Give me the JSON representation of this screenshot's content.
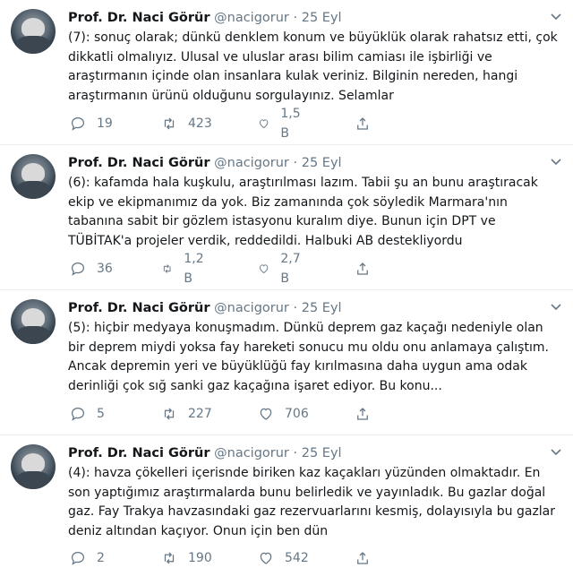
{
  "tweets": [
    {
      "author": "Prof. Dr. Naci Görür",
      "handle": "@nacigorur",
      "sep": "·",
      "date": "25 Eyl",
      "text": "(7): sonuç olarak; dünkü denklem konum ve büyüklük olarak rahatsız etti, çok dikkatli olmalıyız. Ulusal ve uluslar arası bilim camiası ile işbirliği ve araştırmanın içinde olan insanlara kulak veriniz. Bilginin nereden, hangi araştırmanın ürünü olduğunu sorgulayınız. Selamlar",
      "replies": "19",
      "retweets": "423",
      "likes": "1,5 B"
    },
    {
      "author": "Prof. Dr. Naci Görür",
      "handle": "@nacigorur",
      "sep": "·",
      "date": "25 Eyl",
      "text": "(6): kafamda hala kuşkulu, araştırılması lazım. Tabii şu an bunu araştıracak ekip ve ekipmanımız da yok. Biz zamanında çok söyledik Marmara'nın tabanına sabit bir gözlem istasyonu kuralım diye. Bunun için DPT ve TÜBİTAK'a projeler verdik, reddedildi. Halbuki AB destekliyordu",
      "replies": "36",
      "retweets": "1,2 B",
      "likes": "2,7 B"
    },
    {
      "author": "Prof. Dr. Naci Görür",
      "handle": "@nacigorur",
      "sep": "·",
      "date": "25 Eyl",
      "text": "(5): hiçbir medyaya konuşmadım. Dünkü deprem gaz kaçağı nedeniyle olan bir deprem miydi yoksa fay hareketi sonucu mu oldu onu anlamaya çalıştım. Ancak depremin yeri ve büyüklüğü fay kırılmasına daha uygun ama odak derinliği çok sığ sanki gaz kaçağına işaret ediyor. Bu konu...",
      "replies": "5",
      "retweets": "227",
      "likes": "706"
    },
    {
      "author": "Prof. Dr. Naci Görür",
      "handle": "@nacigorur",
      "sep": "·",
      "date": "25 Eyl",
      "text": "(4): havza çökelleri içerisnde biriken kaz kaçakları yüzünden olmaktadır. En son yaptığımız araştırmalarda bunu belirledik ve yayınladık. Bu gazlar doğal gaz. Fay Trakya havzasındaki gaz rezervuarlarını kesmiş, dolayısıyla bu gazlar deniz altından kaçıyor. Onun için ben dün",
      "replies": "2",
      "retweets": "190",
      "likes": "542"
    }
  ]
}
